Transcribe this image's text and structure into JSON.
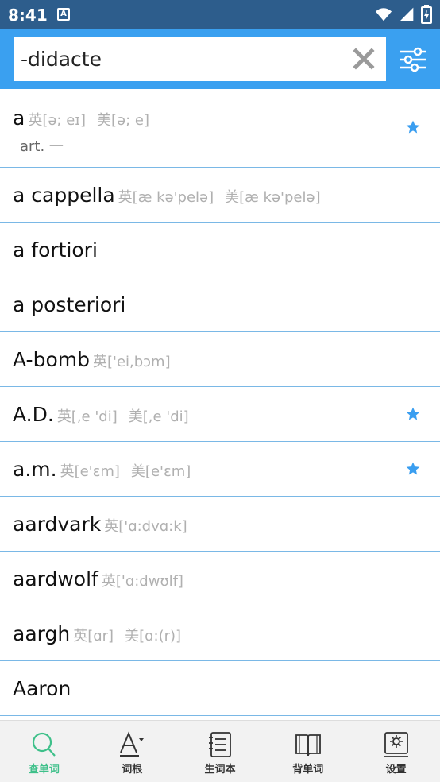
{
  "status": {
    "time": "8:41",
    "app_badge": "A"
  },
  "search": {
    "value": "-didacte",
    "placeholder": ""
  },
  "colors": {
    "accent": "#3aa0f0",
    "status_bar": "#2d5d8c",
    "star": "#3a9ef0",
    "active_tab": "#3ec08a"
  },
  "entries": [
    {
      "word": "a",
      "uk": "英[ə; eɪ]",
      "us": "美[ə; e]",
      "def": "art. 一",
      "starred": true
    },
    {
      "word": "a cappella",
      "uk": "英[æ kə'pelə]",
      "us": "美[æ kə'pelə]",
      "def": "",
      "starred": false
    },
    {
      "word": "a fortiori",
      "uk": "",
      "us": "",
      "def": "",
      "starred": false
    },
    {
      "word": "a posteriori",
      "uk": "",
      "us": "",
      "def": "",
      "starred": false
    },
    {
      "word": "A-bomb",
      "uk": "英['ei,bɔm]",
      "us": "",
      "def": "",
      "starred": false
    },
    {
      "word": "A.D.",
      "uk": "英[,e 'di]",
      "us": "美[,e 'di]",
      "def": "",
      "starred": true
    },
    {
      "word": "a.m.",
      "uk": "英[e'ɛm]",
      "us": "美[e'ɛm]",
      "def": "",
      "starred": true
    },
    {
      "word": "aardvark",
      "uk": "英['ɑ:dvɑ:k]",
      "us": "",
      "def": "",
      "starred": false
    },
    {
      "word": "aardwolf",
      "uk": "英['ɑ:dwʊlf]",
      "us": "",
      "def": "",
      "starred": false
    },
    {
      "word": "aargh",
      "uk": "英[ɑr]",
      "us": "美[ɑ:(r)]",
      "def": "",
      "starred": false
    },
    {
      "word": "Aaron",
      "uk": "",
      "us": "",
      "def": "",
      "starred": false
    }
  ],
  "nav": [
    {
      "label": "查单词",
      "icon": "search-icon",
      "active": true
    },
    {
      "label": "词根",
      "icon": "font-icon",
      "active": false
    },
    {
      "label": "生词本",
      "icon": "notebook-icon",
      "active": false
    },
    {
      "label": "背单词",
      "icon": "book-icon",
      "active": false
    },
    {
      "label": "设置",
      "icon": "settings-icon",
      "active": false
    }
  ]
}
